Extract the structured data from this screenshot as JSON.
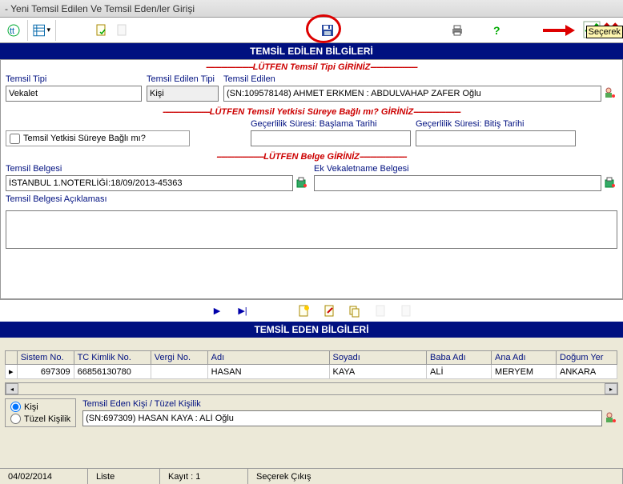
{
  "window": {
    "title": "- Yeni Temsil Edilen Ve Temsil Eden/ler Girişi"
  },
  "tooltip_right": "Seçerek",
  "banner1": "TEMSİL EDİLEN BİLGİLERİ",
  "banner2": "TEMSİL EDEN BİLGİLERİ",
  "legend_tipi": "LÜTFEN Temsil Tipi GİRİNİZ",
  "legend_yetki": "LÜTFEN Temsil Yetkisi Süreye Bağlı mı? GİRİNİZ",
  "legend_belge": "LÜTFEN Belge GİRİNİZ",
  "labels": {
    "temsil_tipi": "Temsil Tipi",
    "temsil_edilen_tipi": "Temsil Edilen Tipi",
    "temsil_edilen": "Temsil Edilen",
    "sureyebagli": "Temsil Yetkisi Süreye Bağlı mı?",
    "baslama": "Geçerlilik Süresi: Başlama Tarihi",
    "bitis": "Geçerlilik Süresi: Bitiş Tarihi",
    "temsil_belgesi": "Temsil Belgesi",
    "ek_vekalet": "Ek Vekaletname Belgesi",
    "aciklama": "Temsil Belgesi Açıklaması",
    "temsil_eden_kisi": "Temsil Eden Kişi / Tüzel Kişilik",
    "radio_kisi": "Kişi",
    "radio_tuzel": "Tüzel Kişilik"
  },
  "values": {
    "temsil_tipi": "Vekalet",
    "temsil_edilen_tipi": "Kişi",
    "temsil_edilen": "(SN:109578148) AHMET ERKMEN : ABDULVAHAP ZAFER Oğlu",
    "baslama": "",
    "bitis": "",
    "temsil_belgesi": "İSTANBUL 1.NOTERLİĞİ:18/09/2013-45363",
    "ek_vekalet": "",
    "aciklama": "",
    "temsil_eden_kisi": "(SN:697309) HASAN KAYA : ALİ Oğlu"
  },
  "table": {
    "cols": [
      "Sistem No.",
      "TC Kimlik No.",
      "Vergi No.",
      "Adı",
      "Soyadı",
      "Baba Adı",
      "Ana Adı",
      "Doğum Yer"
    ],
    "rows": [
      {
        "sistem": "697309",
        "tc": "66856130780",
        "vergi": "",
        "adi": "HASAN",
        "soyadi": "KAYA",
        "baba": "ALİ",
        "ana": "MERYEM",
        "dogum": "ANKARA"
      }
    ]
  },
  "status": {
    "date": "04/02/2014",
    "mode": "Liste",
    "kayit": "Kayıt : 1",
    "secerek": "Seçerek Çıkış"
  }
}
